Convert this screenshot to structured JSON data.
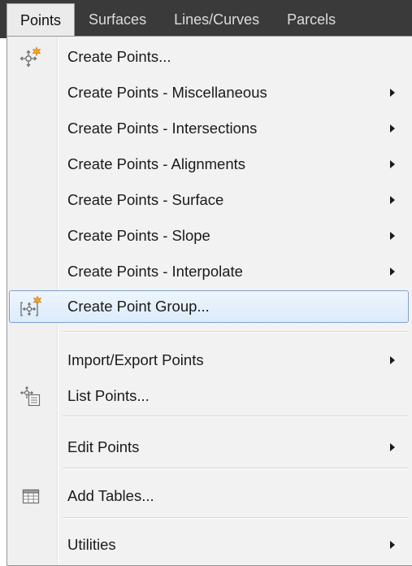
{
  "menubar": {
    "items": [
      {
        "label": "Points",
        "active": true
      },
      {
        "label": "Surfaces",
        "active": false
      },
      {
        "label": "Lines/Curves",
        "active": false
      },
      {
        "label": "Parcels",
        "active": false
      }
    ]
  },
  "menu": {
    "items": [
      {
        "label": "Create Points...",
        "icon": "create-points-icon",
        "submenu": false
      },
      {
        "label": "Create Points - Miscellaneous",
        "submenu": true
      },
      {
        "label": "Create Points - Intersections",
        "submenu": true
      },
      {
        "label": "Create Points - Alignments",
        "submenu": true
      },
      {
        "label": "Create Points - Surface",
        "submenu": true
      },
      {
        "label": "Create Points - Slope",
        "submenu": true
      },
      {
        "label": "Create Points - Interpolate",
        "submenu": true
      },
      {
        "label": "Create Point Group...",
        "icon": "point-group-icon",
        "submenu": false,
        "highlighted": true
      },
      {
        "label": "Import/Export Points",
        "submenu": true
      },
      {
        "label": "List Points...",
        "icon": "list-points-icon",
        "submenu": false
      },
      {
        "label": "Edit Points",
        "submenu": true
      },
      {
        "label": "Add Tables...",
        "icon": "table-icon",
        "submenu": false
      },
      {
        "label": "Utilities",
        "submenu": true
      }
    ]
  },
  "colors": {
    "menubar_bg": "#3a3a3a",
    "menu_bg": "#f2f2f2",
    "highlight_border": "#7da2ce",
    "accent_orange": "#f5a623"
  }
}
